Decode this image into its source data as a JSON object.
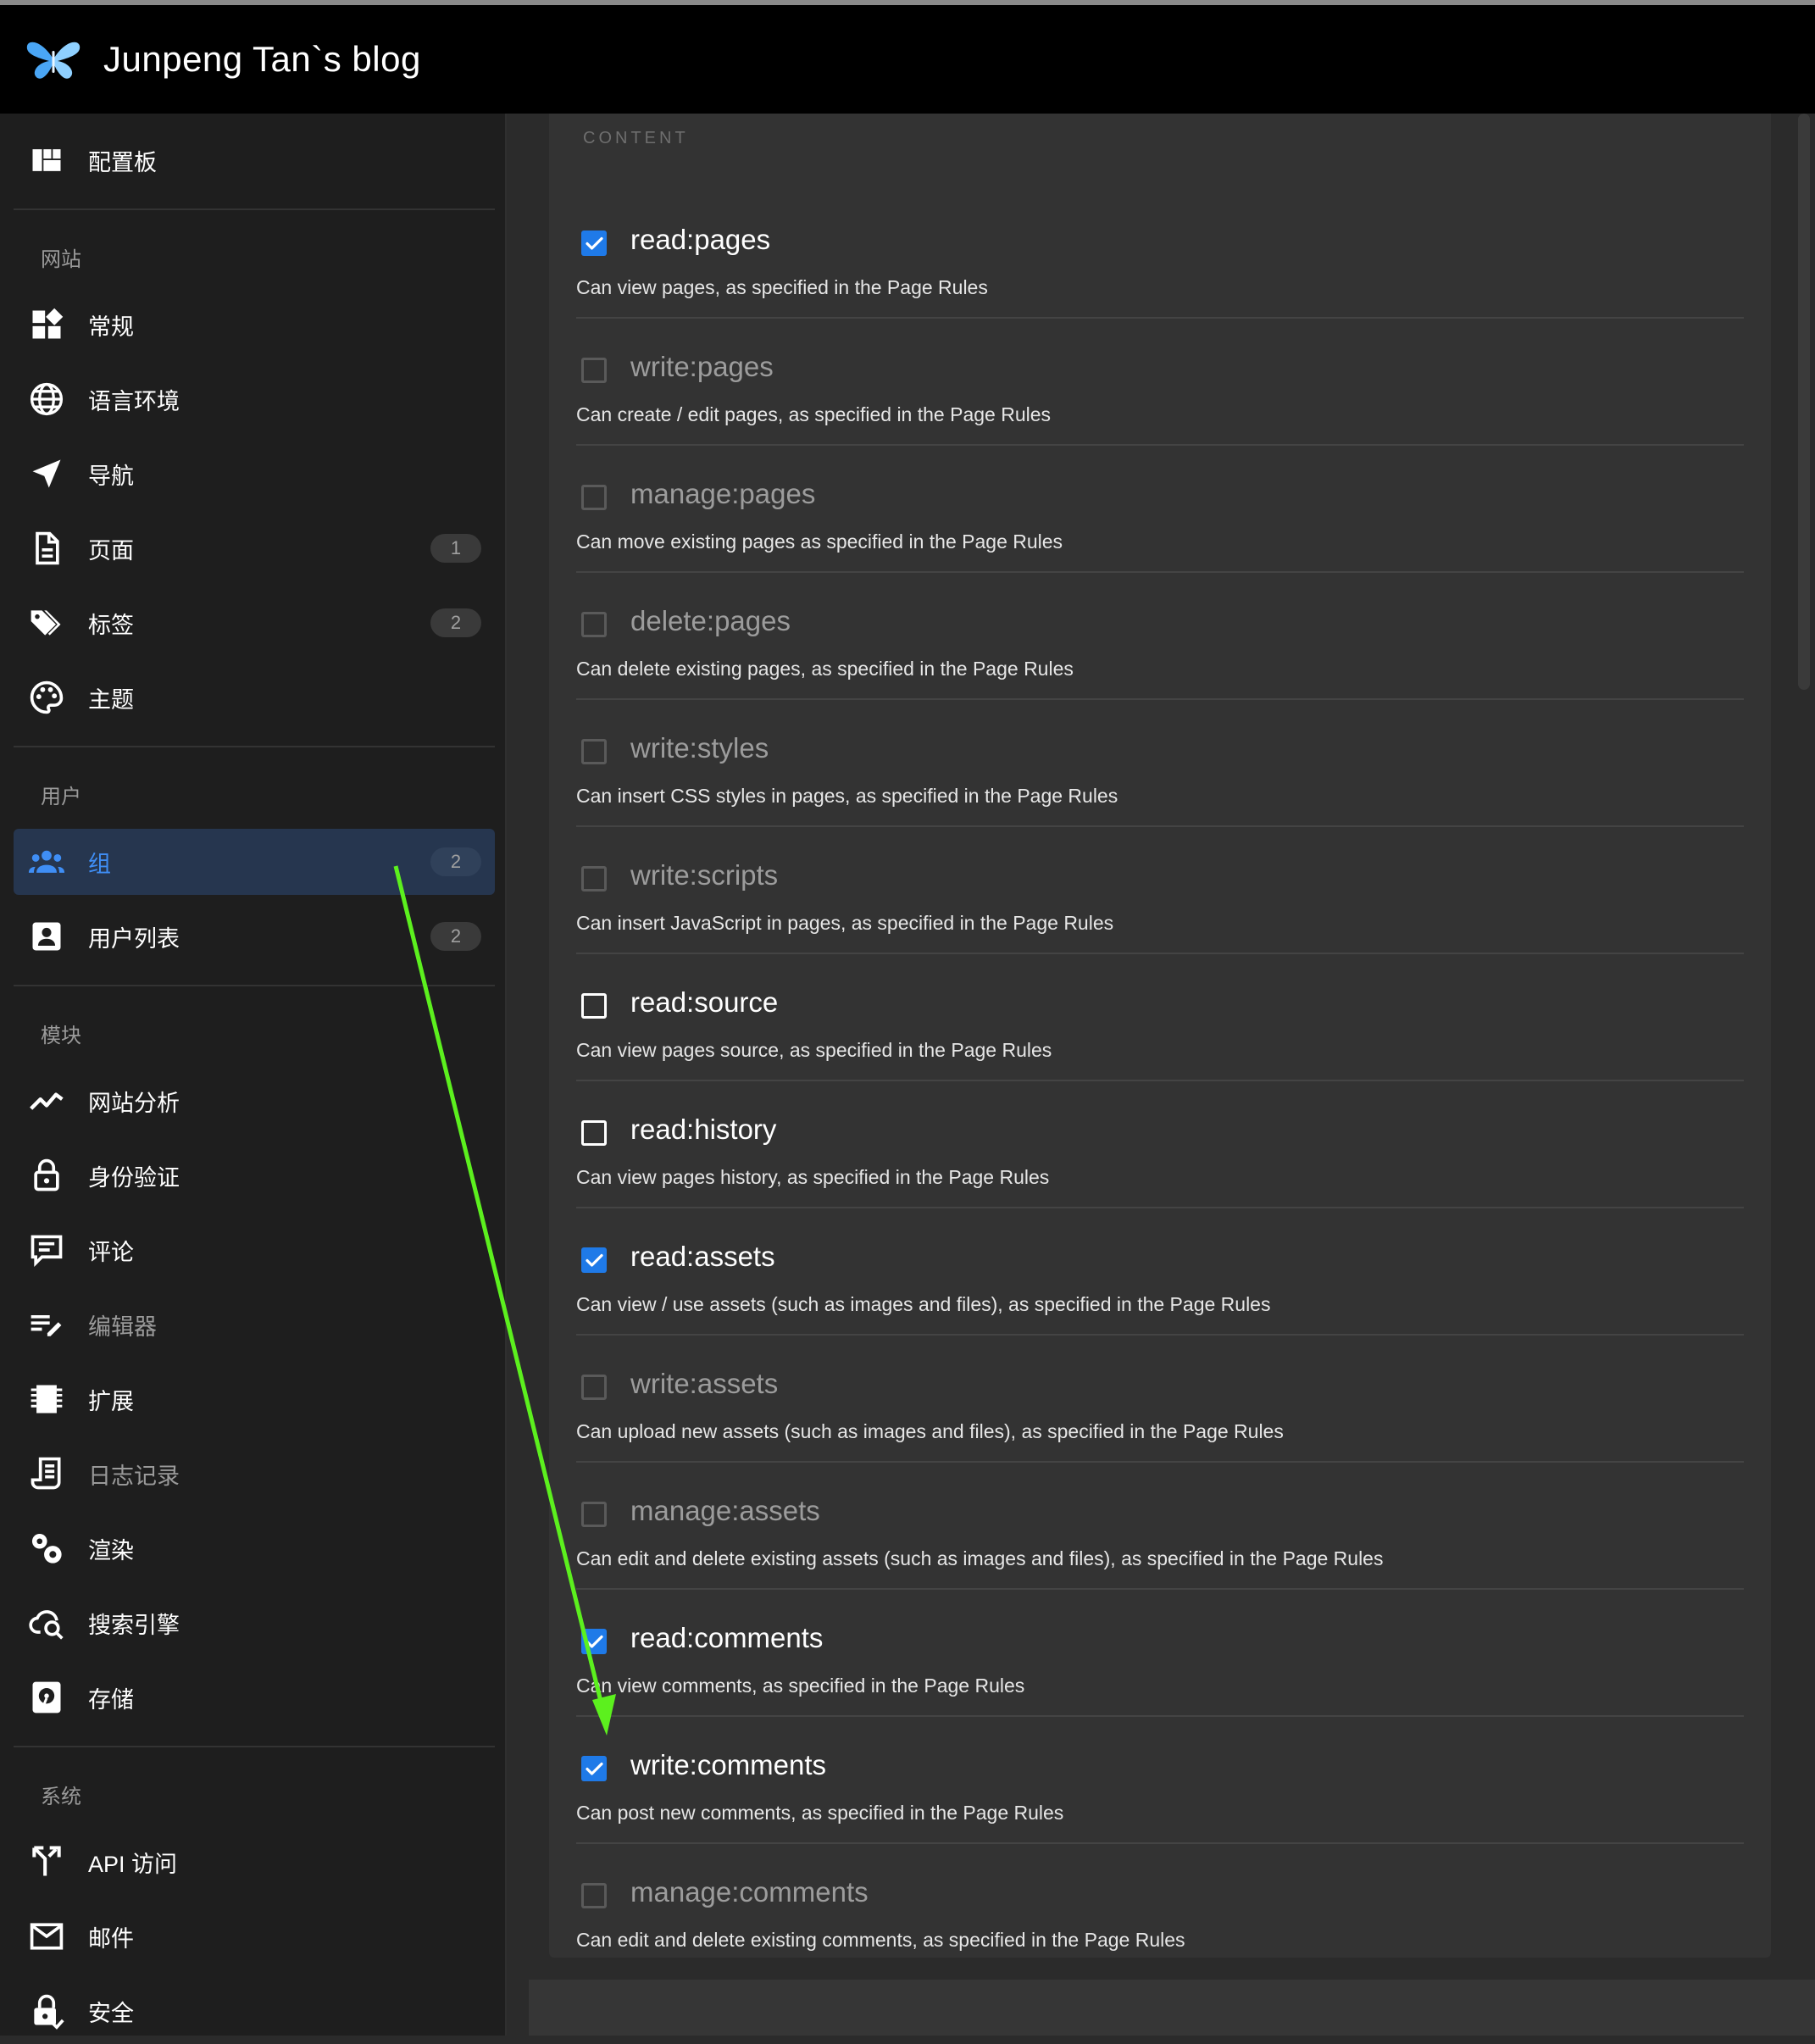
{
  "header": {
    "title": "Junpeng Tan`s blog"
  },
  "sidebar": {
    "dashboard": "配置板",
    "sections": {
      "site": "网站",
      "users": "用户",
      "modules": "模块",
      "system": "系统"
    },
    "items": {
      "general": "常规",
      "locale": "语言环境",
      "navigation": "导航",
      "pages": "页面",
      "pages_count": "1",
      "tags": "标签",
      "tags_count": "2",
      "theme": "主题",
      "groups": "组",
      "groups_count": "2",
      "users": "用户列表",
      "users_count": "2",
      "analytics": "网站分析",
      "auth": "身份验证",
      "comments": "评论",
      "editor": "编辑器",
      "extensions": "扩展",
      "logging": "日志记录",
      "rendering": "渲染",
      "search": "搜索引擎",
      "storage": "存储",
      "api": "API 访问",
      "mail": "邮件",
      "security": "安全"
    }
  },
  "content": {
    "section_label": "CONTENT",
    "permissions": [
      {
        "name": "read:pages",
        "desc": "Can view pages, as specified in the Page Rules",
        "checked": true
      },
      {
        "name": "write:pages",
        "desc": "Can create / edit pages, as specified in the Page Rules",
        "checked": false
      },
      {
        "name": "manage:pages",
        "desc": "Can move existing pages as specified in the Page Rules",
        "checked": false
      },
      {
        "name": "delete:pages",
        "desc": "Can delete existing pages, as specified in the Page Rules",
        "checked": false
      },
      {
        "name": "write:styles",
        "desc": "Can insert CSS styles in pages, as specified in the Page Rules",
        "checked": false
      },
      {
        "name": "write:scripts",
        "desc": "Can insert JavaScript in pages, as specified in the Page Rules",
        "checked": false
      },
      {
        "name": "read:source",
        "desc": "Can view pages source, as specified in the Page Rules",
        "checked": false
      },
      {
        "name": "read:history",
        "desc": "Can view pages history, as specified in the Page Rules",
        "checked": false
      },
      {
        "name": "read:assets",
        "desc": "Can view / use assets (such as images and files), as specified in the Page Rules",
        "checked": true
      },
      {
        "name": "write:assets",
        "desc": "Can upload new assets (such as images and files), as specified in the Page Rules",
        "checked": false
      },
      {
        "name": "manage:assets",
        "desc": "Can edit and delete existing assets (such as images and files), as specified in the Page Rules",
        "checked": false
      },
      {
        "name": "read:comments",
        "desc": "Can view comments, as specified in the Page Rules",
        "checked": true
      },
      {
        "name": "write:comments",
        "desc": "Can post new comments, as specified in the Page Rules",
        "checked": true
      },
      {
        "name": "manage:comments",
        "desc": "Can edit and delete existing comments, as specified in the Page Rules",
        "checked": false
      }
    ]
  },
  "colors": {
    "accent": "#1f7ae8",
    "active_nav_bg": "#26364f",
    "annotation_arrow": "#5cf01e"
  }
}
